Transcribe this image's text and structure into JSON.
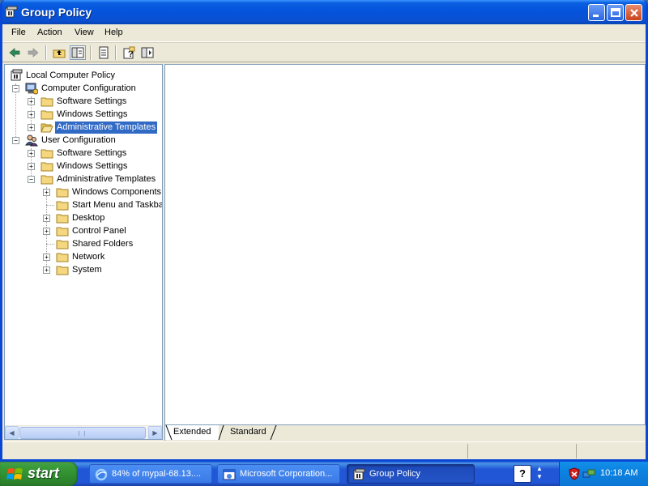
{
  "window": {
    "title": "Group Policy"
  },
  "menu": [
    "File",
    "Action",
    "View",
    "Help"
  ],
  "tree": {
    "root": "Local Computer Policy",
    "computer_config": "Computer Configuration",
    "cc_software": "Software Settings",
    "cc_windows": "Windows Settings",
    "cc_admin": "Administrative Templates",
    "user_config": "User Configuration",
    "uc_software": "Software Settings",
    "uc_windows": "Windows Settings",
    "uc_admin": "Administrative Templates",
    "uc_components": "Windows Components",
    "uc_startmenu": "Start Menu and Taskbar",
    "uc_desktop": "Desktop",
    "uc_controlpanel": "Control Panel",
    "uc_sharedfolders": "Shared Folders",
    "uc_network": "Network",
    "uc_system": "System"
  },
  "tabs": {
    "extended": "Extended",
    "standard": "Standard"
  },
  "taskbar": {
    "start": "start",
    "tasks": [
      {
        "label": "84% of mypal-68.13....",
        "icon": "ie-download-icon"
      },
      {
        "label": "Microsoft Corporation...",
        "icon": "window-icon"
      },
      {
        "label": "Group Policy",
        "icon": "group-policy-icon"
      }
    ],
    "help": "?",
    "clock": "10:18 AM"
  },
  "colors": {
    "selection": "#316ac5",
    "titlebar": "#0454dc",
    "taskbar": "#2157d7",
    "start": "#3c9d3c"
  }
}
